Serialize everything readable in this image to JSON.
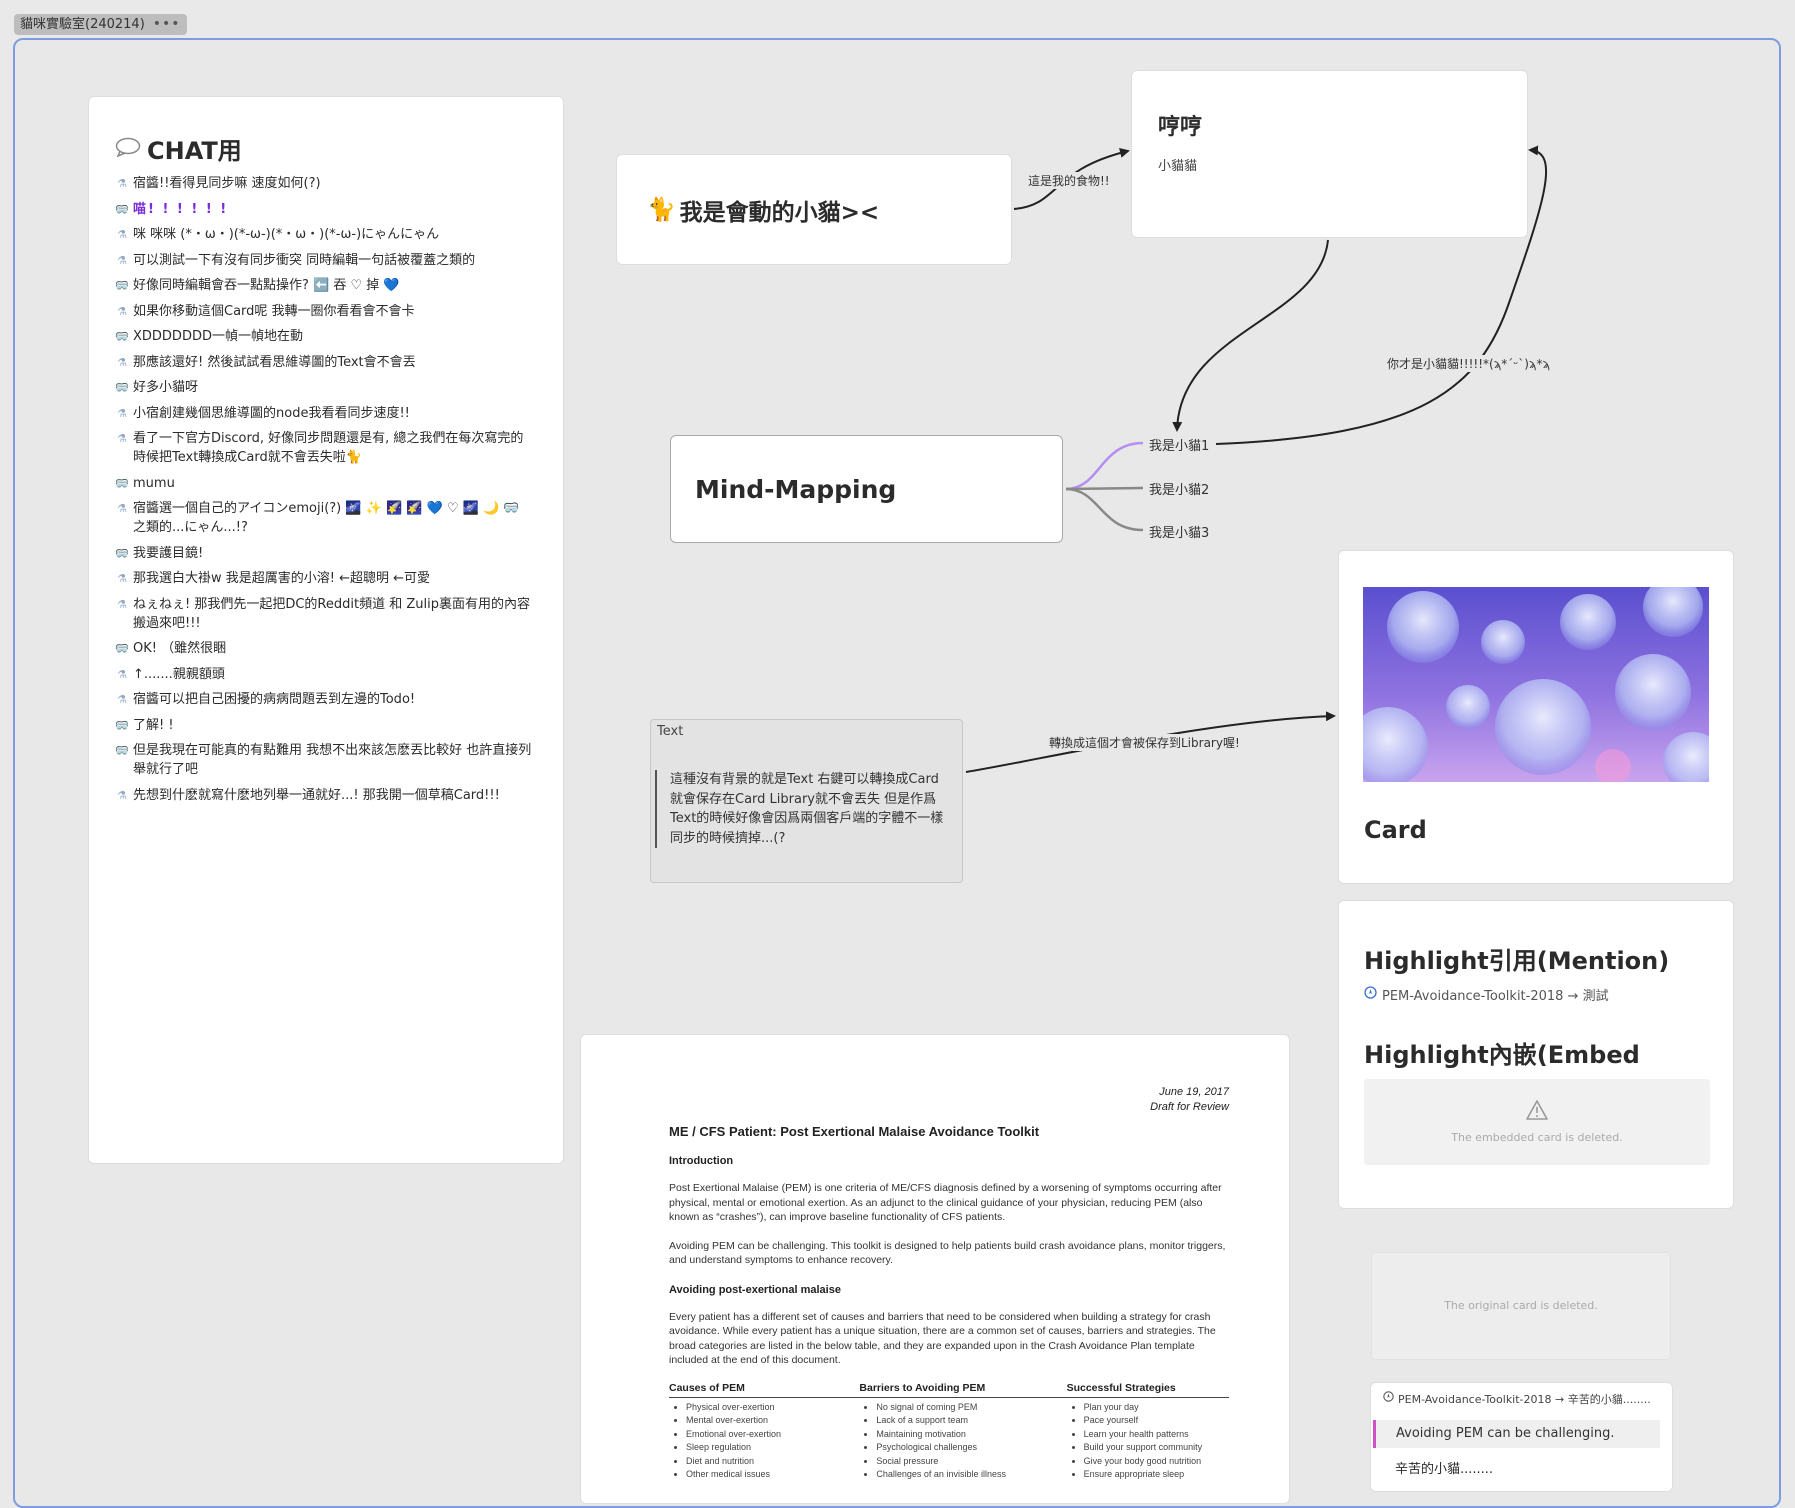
{
  "board": {
    "tab_title": "貓咪實驗室(240214)",
    "tab_menu": "•••"
  },
  "chat": {
    "title": "CHAT用",
    "messages": [
      {
        "who": "a",
        "text": "宿醬!!看得見同步嘛 速度如何(?)"
      },
      {
        "who": "b",
        "text": "喵! ! ! ! ! !",
        "style": "purple"
      },
      {
        "who": "a",
        "text": "咪 咪咪 (*・ω・)(*-ω-)(*・ω・)(*-ω-)にゃんにゃん"
      },
      {
        "who": "a",
        "text": "可以測試一下有沒有同步衝突 同時編輯一句話被覆蓋之類的"
      },
      {
        "who": "b",
        "text": "好像同時編輯會吞一點點操作? ⬅️ 吞 ♡ 掉 💙"
      },
      {
        "who": "a",
        "text": "如果你移動這個Card呢 我轉一圈你看看會不會卡"
      },
      {
        "who": "b",
        "text": "XDDDDDDD一幀一幀地在動"
      },
      {
        "who": "a",
        "text": "那應該還好! 然後試試看思維導圖的Text會不會丟"
      },
      {
        "who": "b",
        "text": "好多小貓呀"
      },
      {
        "who": "a",
        "text": "小宿創建幾個思維導圖的node我看看同步速度!!"
      },
      {
        "who": "a",
        "text": "看了一下官方Discord, 好像同步問題還是有, 總之我們在每次寫完的時候把Text轉換成Card就不會丟失啦🐈"
      },
      {
        "who": "b",
        "text": "mumu"
      },
      {
        "who": "a",
        "text": "宿醬選一個自己的アイコンemoji(?) 🌌 ✨ 🌠 🌠 💙 ♡ 🌌 🌙 🥽 之類的...にゃん...!?"
      },
      {
        "who": "b",
        "text": "我要護目鏡!"
      },
      {
        "who": "a",
        "text": "那我選白大褂w 我是超厲害的小溶! ←超聰明 ←可愛"
      },
      {
        "who": "a",
        "text": "ねぇねぇ! 那我們先一起把DC的Reddit頻道 和 Zulip裏面有用的內容搬過來吧!!!"
      },
      {
        "who": "b",
        "text": "OK! （雖然很睏"
      },
      {
        "who": "a",
        "text": "↑.......親親額頭"
      },
      {
        "who": "a",
        "text": "宿醬可以把自己困擾的病病問題丟到左邊的Todo!"
      },
      {
        "who": "b",
        "text": "了解! !"
      },
      {
        "who": "b",
        "text": "但是我現在可能真的有點難用 我想不出來該怎麽丟比較好 也許直接列舉就行了吧"
      },
      {
        "who": "a",
        "text": "先想到什麽就寫什麽地列舉一通就好...! 那我開一個草稿Card!!!"
      }
    ]
  },
  "nodes": {
    "cat_card": {
      "emoji": "🐈",
      "text": "我是會動的小貓><"
    },
    "heng_card": {
      "title": "哼哼",
      "subtitle": "小貓貓"
    },
    "mindmap": {
      "root": "Mind-Mapping",
      "children": [
        "我是小貓1",
        "我是小貓2",
        "我是小貓3"
      ]
    },
    "text_node": {
      "label": "Text",
      "body": "這種沒有背景的就是Text 右鍵可以轉換成Card 就會保存在Card Library就不會丟失 但是作爲Text的時候好像會因爲兩個客戶端的字體不一樣 同步的時候擠掉...(?"
    },
    "image_card": {
      "caption": "Card"
    },
    "highlight_card": {
      "mention_title": "Highlight引用(Mention)",
      "mention_ref": "PEM-Avoidance-Toolkit-2018 → 測試",
      "embed_title": "Highlight內嵌(Embed",
      "embed_deleted": "The embedded card is deleted."
    },
    "original_deleted": "The original card is deleted.",
    "quote_card": {
      "source": "PEM-Avoidance-Toolkit-2018 → 辛苦的小貓........",
      "quote": "Avoiding PEM can be challenging.",
      "note": "辛苦的小貓........"
    }
  },
  "edges": {
    "food": "這是我的食物!!",
    "you_cat": "你才是小貓貓!!!!!*(ϡ*ˊᵕˋ)ϡ*ϡ",
    "library": "轉換成這個才會被保存到Library喔!"
  },
  "document": {
    "date": "June 19, 2017",
    "status": "Draft for Review",
    "title": "ME / CFS Patient: Post Exertional Malaise Avoidance Toolkit",
    "intro_heading": "Introduction",
    "intro_p1": "Post Exertional Malaise (PEM) is one criteria of ME/CFS diagnosis defined by a worsening of symptoms occurring after physical, mental or emotional exertion. As an adjunct to the clinical guidance of your physician, reducing PEM (also known as “crashes”), can improve baseline functionality of CFS patients.",
    "intro_p2": "Avoiding PEM can be challenging. This toolkit is designed to help patients build crash avoidance plans, monitor triggers, and understand symptoms to enhance recovery.",
    "section_heading": "Avoiding post-exertional malaise",
    "section_p": "Every patient has a different set of causes and barriers that need to be considered when building a strategy for crash avoidance. While every patient has a unique situation, there are a common set of causes, barriers and strategies. The broad categories are listed in the below table, and they are expanded upon in the Crash Avoidance Plan template included at the end of this document.",
    "table": {
      "headers": [
        "Causes of PEM",
        "Barriers to Avoiding PEM",
        "Successful Strategies"
      ],
      "columns": [
        [
          "Physical over-exertion",
          "Mental over-exertion",
          "Emotional over-exertion",
          "Sleep regulation",
          "Diet and nutrition",
          "Other medical issues"
        ],
        [
          "No signal of coming PEM",
          "Lack of a support team",
          "Maintaining motivation",
          "Psychological challenges",
          "Social pressure",
          "Challenges of an invisible illness"
        ],
        [
          "Plan your day",
          "Pace yourself",
          "Learn your health patterns",
          "Build your support community",
          "Give your body good nutrition",
          "Ensure appropriate sleep"
        ]
      ]
    }
  }
}
